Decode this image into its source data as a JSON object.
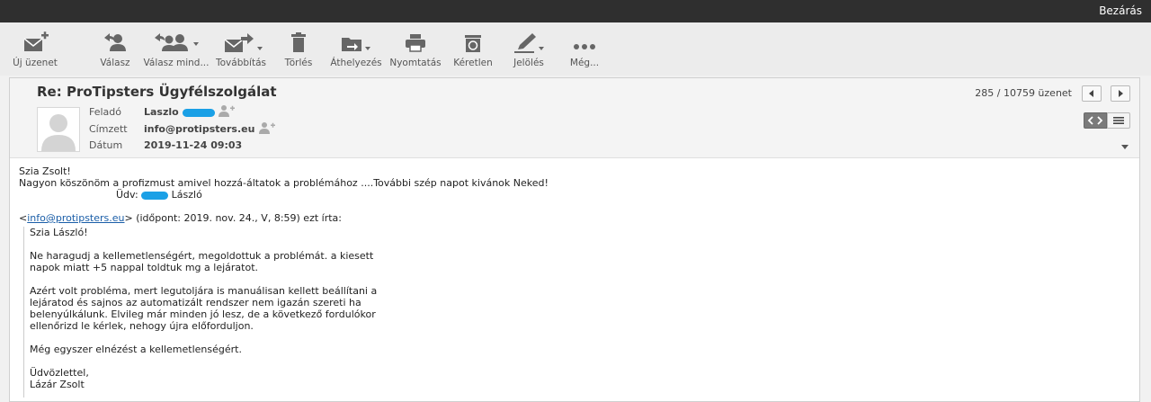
{
  "topbar": {
    "close_label": "Bezárás"
  },
  "toolbar": {
    "new_message": "Új üzenet",
    "reply": "Válasz",
    "reply_all": "Válasz mind...",
    "forward": "Továbbítás",
    "delete": "Törlés",
    "move": "Áthelyezés",
    "print": "Nyomtatás",
    "spam": "Kéretlen",
    "mark": "Jelölés",
    "more": "Még..."
  },
  "message": {
    "subject": "Re: ProTipsters Ügyfélszolgálat",
    "from_label": "Feladó",
    "from_value": "Laszlo",
    "to_label": "Címzett",
    "to_value": "info@protipsters.eu",
    "date_label": "Dátum",
    "date_value": "2019-11-24 09:03",
    "counter": "285 / 10759 üzenet"
  },
  "body": {
    "line1": "Szia Zsolt!",
    "line2": "Nagyon köszönöm a profizmust amivel hozzá-áltatok a problémához ....További szép napot kivánok Neked!",
    "line3_prefix": "Üdv:",
    "line3_suffix": " László",
    "quote_lt": "<",
    "quote_email": "info@protipsters.eu",
    "quote_header": "> (időpont: 2019. nov. 24., V, 8:59) ezt írta:",
    "q1": "Szia László!",
    "q2": "Ne haragudj a kellemetlenségért, megoldottuk a problémát. a kiesett",
    "q3": "napok miatt +5 nappal toldtuk mg a lejáratot.",
    "q4": "Azért volt probléma, mert legutoljára is manuálisan kellett beállítani a",
    "q5": "lejáratod és sajnos az automatizált rendszer nem igazán szereti ha",
    "q6": "belenyúlkálunk. Elvileg már minden jó lesz, de a következő fordulókor",
    "q7": "ellenőrizd le kérlek, nehogy újra előforduljon.",
    "q8": "Még egyszer elnézést a kellemetlenségért.",
    "q9": "Üdvözlettel,",
    "q10": "Lázár Zsolt"
  },
  "colors": {
    "topbar": "#2f2f2f",
    "redaction": "#1aa0e6",
    "link": "#1a5ea8"
  }
}
